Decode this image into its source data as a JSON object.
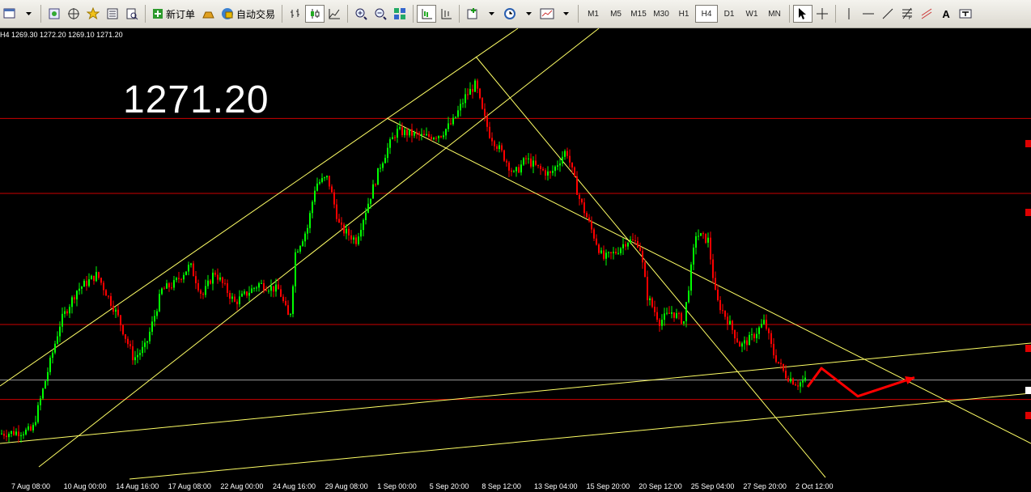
{
  "toolbar": {
    "new_order_label": "新订单",
    "auto_trade_label": "自动交易",
    "timeframes": [
      "M1",
      "M5",
      "M15",
      "M30",
      "H1",
      "H4",
      "D1",
      "W1",
      "MN"
    ],
    "active_timeframe": "H4",
    "text_tool_label": "A"
  },
  "chart": {
    "ohlc_text": "H4  1269.30 1272.20 1269.10 1271.20",
    "big_price": "1271.20",
    "x_labels": [
      "7 Aug 08:00",
      "10 Aug 00:00",
      "14 Aug 16:00",
      "17 Aug 08:00",
      "22 Aug 00:00",
      "24 Aug 16:00",
      "29 Aug 08:00",
      "1 Sep 00:00",
      "5 Sep 20:00",
      "8 Sep 12:00",
      "13 Sep 04:00",
      "15 Sep 20:00",
      "20 Sep 12:00",
      "25 Sep 04:00",
      "27 Sep 20:00",
      "2 Oct 12:00"
    ],
    "colors": {
      "background": "#000000",
      "bull": "#00ff00",
      "bear": "#ff0000",
      "trendline": "#ffff66",
      "level": "#cc0000",
      "arrow": "#ff0000"
    }
  },
  "chart_data": {
    "type": "candlestick",
    "symbol_timeframe": "H4",
    "last_close": 1271.2,
    "y_range": [
      1240,
      1380
    ],
    "series_shape": "left-to-right price path: rises from ~1250 to peak ~1366 near 8 Sep, then declines to ~1270 near 2 Oct",
    "path_points": [
      [
        0,
        1254
      ],
      [
        40,
        1255
      ],
      [
        55,
        1270
      ],
      [
        75,
        1290
      ],
      [
        95,
        1300
      ],
      [
        120,
        1305
      ],
      [
        145,
        1292
      ],
      [
        165,
        1278
      ],
      [
        180,
        1282
      ],
      [
        200,
        1300
      ],
      [
        215,
        1302
      ],
      [
        235,
        1308
      ],
      [
        250,
        1298
      ],
      [
        265,
        1306
      ],
      [
        290,
        1296
      ],
      [
        320,
        1302
      ],
      [
        345,
        1300
      ],
      [
        358,
        1290
      ],
      [
        365,
        1312
      ],
      [
        380,
        1320
      ],
      [
        390,
        1334
      ],
      [
        405,
        1336
      ],
      [
        420,
        1320
      ],
      [
        440,
        1316
      ],
      [
        455,
        1328
      ],
      [
        470,
        1340
      ],
      [
        480,
        1346
      ],
      [
        490,
        1351
      ],
      [
        510,
        1350
      ],
      [
        525,
        1349
      ],
      [
        545,
        1350
      ],
      [
        560,
        1354
      ],
      [
        575,
        1362
      ],
      [
        588,
        1366
      ],
      [
        595,
        1358
      ],
      [
        605,
        1350
      ],
      [
        620,
        1344
      ],
      [
        635,
        1337
      ],
      [
        650,
        1342
      ],
      [
        665,
        1339
      ],
      [
        680,
        1337
      ],
      [
        700,
        1345
      ],
      [
        715,
        1330
      ],
      [
        730,
        1320
      ],
      [
        745,
        1310
      ],
      [
        760,
        1312
      ],
      [
        775,
        1316
      ],
      [
        790,
        1315
      ],
      [
        800,
        1298
      ],
      [
        815,
        1290
      ],
      [
        830,
        1293
      ],
      [
        845,
        1290
      ],
      [
        860,
        1318
      ],
      [
        875,
        1316
      ],
      [
        885,
        1297
      ],
      [
        900,
        1290
      ],
      [
        915,
        1282
      ],
      [
        930,
        1285
      ],
      [
        945,
        1290
      ],
      [
        955,
        1280
      ],
      [
        970,
        1273
      ],
      [
        985,
        1270
      ],
      [
        995,
        1271
      ]
    ],
    "horizontal_levels": [
      1355,
      1331,
      1289,
      1265
    ],
    "forecast_arrow": [
      [
        998,
        1269
      ],
      [
        1015,
        1275
      ],
      [
        1060,
        1266
      ],
      [
        1130,
        1272
      ]
    ]
  }
}
